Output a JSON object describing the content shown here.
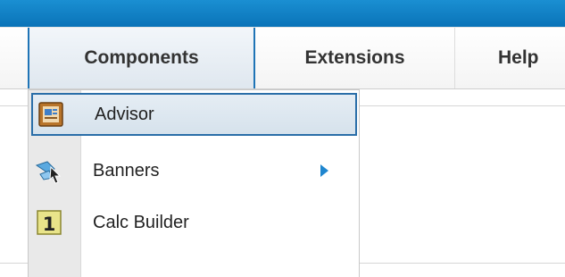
{
  "colors": {
    "topbar": "#0a73b8",
    "active_border": "#2a6ea8",
    "submenu_arrow": "#1f86cf"
  },
  "menubar": {
    "items": [
      {
        "label": "Components",
        "active": true
      },
      {
        "label": "Extensions"
      },
      {
        "label": "Help"
      }
    ]
  },
  "dropdown": {
    "items": [
      {
        "label": "Advisor",
        "icon": "advisor-icon",
        "highlighted": true
      },
      {
        "label": "Banners",
        "icon": "banners-icon",
        "has_submenu": true
      },
      {
        "label": "Calc Builder",
        "icon": "calc-builder-icon",
        "icon_text": "1"
      }
    ]
  }
}
